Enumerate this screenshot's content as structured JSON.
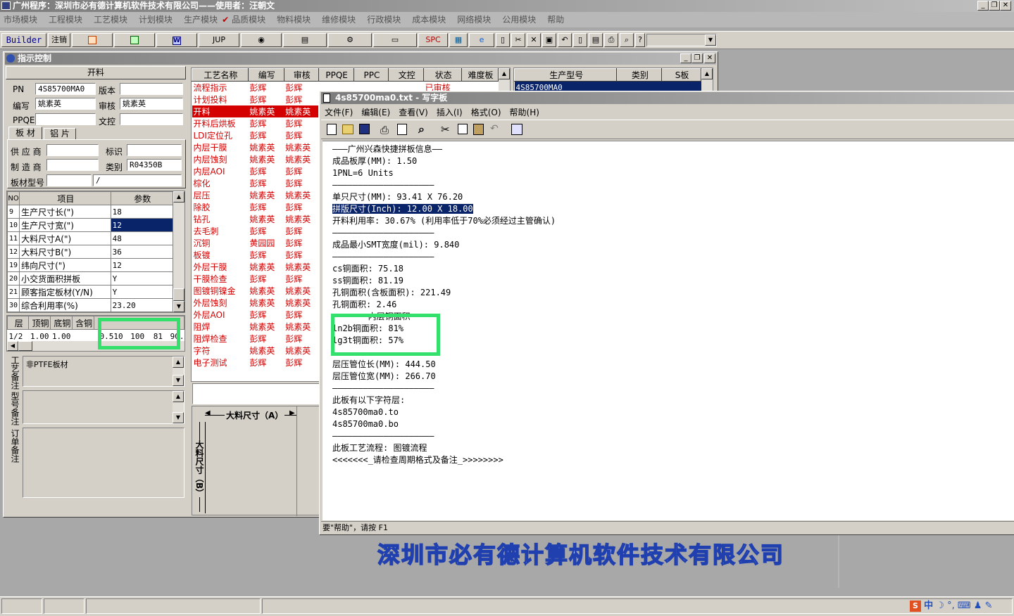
{
  "app": {
    "title": "广州程序：深圳市必有德计算机软件技术有限公司——使用者：汪朝文",
    "menu": [
      "市场模块",
      "工程模块",
      "工艺模块",
      "计划模块",
      "生产模块",
      "品质模块",
      "物料模块",
      "维修模块",
      "行政模块",
      "成本模块",
      "网络模块",
      "公用模块",
      "帮助"
    ],
    "check_mark": "✔"
  },
  "toolbar": {
    "builder": "Builder",
    "logout": "注销",
    "jup": "JUP",
    "spc": "SPC"
  },
  "child_window": {
    "title": "指示控制",
    "section_title": "开料",
    "pn_label": "PN",
    "pn_value": "4S85700MA0",
    "version_label": "版本",
    "version_value": "",
    "writer_label": "编写",
    "writer_value": "姚素英",
    "review_label": "审核",
    "review_value": "姚素英",
    "ppqe_label": "PPQE",
    "ppqe_value": "",
    "doc_label": "文控",
    "doc_value": "",
    "tabs": [
      "板 材",
      "铝 片"
    ],
    "supplier_label": "供 应 商",
    "supplier_value": "",
    "mark_label": "标识",
    "mark_value": "",
    "maker_label": "制 造 商",
    "maker_value": "",
    "category_label": "类别",
    "category_value": "R04350B",
    "board_type_label": "板材型号",
    "board_type_value": "",
    "board_type_value2": "/",
    "param_headers": [
      "NO",
      "项目",
      "参数"
    ],
    "params": [
      {
        "no": "9",
        "item": "生产尺寸长(\")",
        "val": "18"
      },
      {
        "no": "10",
        "item": "生产尺寸宽(\")",
        "val": "12"
      },
      {
        "no": "11",
        "item": "大料尺寸A(\")",
        "val": "48"
      },
      {
        "no": "12",
        "item": "大料尺寸B(\")",
        "val": "36"
      },
      {
        "no": "19",
        "item": "纬向尺寸(\")",
        "val": "12"
      },
      {
        "no": "20",
        "item": "小交货面积拼板",
        "val": "Y"
      },
      {
        "no": "21",
        "item": "顾客指定板材(Y/N)",
        "val": "Y"
      },
      {
        "no": "30",
        "item": "综合利用率(%)",
        "val": "23.20"
      }
    ],
    "layer_headers": [
      "层",
      "顶铜",
      "底铜",
      "含铜"
    ],
    "layer_row": [
      "1/2",
      "1.00",
      "1.00"
    ],
    "layer_row_extra": [
      "0.510",
      "100",
      "81",
      "90."
    ],
    "process_note_label": "工艺备注",
    "process_note_value": "非PTFE板材",
    "model_note_label": "型号备注",
    "order_note_label": "订单备注",
    "proc_headers": [
      "工艺名称",
      "编写",
      "审核",
      "PPQE",
      "PPC",
      "文控",
      "状态",
      "难度板"
    ],
    "procs": [
      {
        "name": "流程指示",
        "w": "彭辉",
        "r": "彭辉",
        "status": "已审核"
      },
      {
        "name": "计划投料",
        "w": "彭辉",
        "r": "彭辉"
      },
      {
        "name": "开料",
        "w": "姚素英",
        "r": "姚素英"
      },
      {
        "name": "开料后烘板",
        "w": "彭辉",
        "r": "彭辉"
      },
      {
        "name": "LDI定位孔",
        "w": "彭辉",
        "r": "彭辉"
      },
      {
        "name": "内层干膜",
        "w": "姚素英",
        "r": "姚素英"
      },
      {
        "name": "内层蚀刻",
        "w": "姚素英",
        "r": "姚素英"
      },
      {
        "name": "内层AOI",
        "w": "彭辉",
        "r": "彭辉"
      },
      {
        "name": "棕化",
        "w": "彭辉",
        "r": "彭辉"
      },
      {
        "name": "层压",
        "w": "姚素英",
        "r": "姚素英"
      },
      {
        "name": "除胶",
        "w": "彭辉",
        "r": "彭辉"
      },
      {
        "name": "钻孔",
        "w": "姚素英",
        "r": "姚素英"
      },
      {
        "name": "去毛刺",
        "w": "彭辉",
        "r": "彭辉"
      },
      {
        "name": "沉铜",
        "w": "黄园园",
        "r": "彭辉"
      },
      {
        "name": "板镀",
        "w": "彭辉",
        "r": "彭辉"
      },
      {
        "name": "外层干膜",
        "w": "姚素英",
        "r": "姚素英"
      },
      {
        "name": "干膜检查",
        "w": "彭辉",
        "r": "彭辉"
      },
      {
        "name": "图镀铜镍金",
        "w": "姚素英",
        "r": "姚素英"
      },
      {
        "name": "外层蚀刻",
        "w": "姚素英",
        "r": "姚素英"
      },
      {
        "name": "外层AOI",
        "w": "彭辉",
        "r": "彭辉"
      },
      {
        "name": "阻焊",
        "w": "姚素英",
        "r": "姚素英"
      },
      {
        "name": "阻焊检查",
        "w": "彭辉",
        "r": "彭辉"
      },
      {
        "name": "字符",
        "w": "姚素英",
        "r": "姚素英"
      },
      {
        "name": "电子测试",
        "w": "彭辉",
        "r": "彭辉"
      }
    ],
    "right_headers": [
      "生产型号",
      "类别",
      "S板"
    ],
    "right_row": "4S85700MA0",
    "dim_a": "大料尺寸（A）",
    "dim_b": "大料尺寸（B）"
  },
  "notepad": {
    "title": "4s85700ma0.txt - 写字板",
    "menu": [
      "文件(F)",
      "编辑(E)",
      "查看(V)",
      "插入(I)",
      "格式(O)",
      "帮助(H)"
    ],
    "lines": [
      "———广州兴森快捷拼板信息——",
      "成品板厚(MM): 1.50",
      "1PNL=6 Units",
      "————————————————————",
      "单只尺寸(MM): 93.41 X 76.20",
      "拼版尺寸(Inch): 12.00 X 18.00",
      "开料利用率: 30.67% (利用率低于70%必须经过主管确认)",
      "————————————————————",
      "成品最小SMT宽度(mil): 9.840",
      "————————————————————",
      "cs铜面积: 75.18",
      "ss铜面积: 81.19",
      "孔铜面积(含板面积): 221.49",
      "孔铜面积: 2.46",
      "———————内层铜面积——",
      "ln2b铜面积: 81%",
      "lg3t铜面积: 57%",
      "————————————————————",
      "层压管位长(MM): 444.50",
      "层压管位宽(MM): 266.70",
      "————————————————————",
      "此板有以下字符层:",
      "4s85700ma0.to",
      "4s85700ma0.bo",
      "————————————————————",
      "此板工艺流程: 图镀流程",
      "<<<<<<<_请检查周期格式及备注_>>>>>>>>"
    ],
    "status": "要\"帮助\"，请按 F1"
  },
  "watermark": "深圳市必有德计算机软件技术有限公司",
  "tray": {
    "ime": "中"
  }
}
